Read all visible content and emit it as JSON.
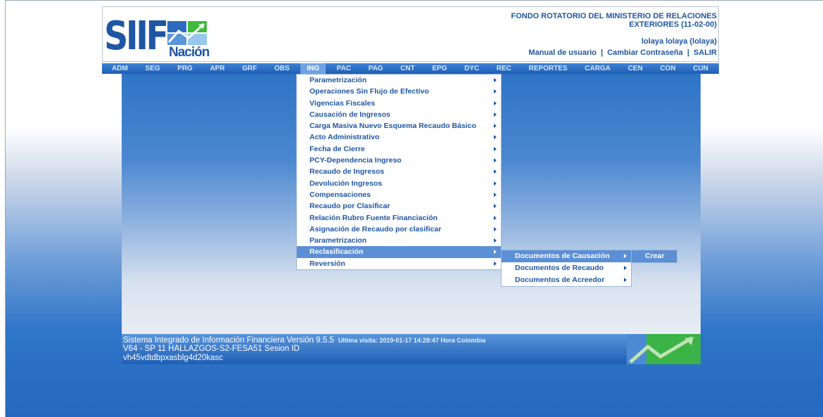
{
  "header": {
    "logo_text": "SIIF",
    "logo_subtext": "Nación",
    "org_name": "FONDO ROTATORIO DEL MINISTERIO DE RELACIONES EXTERIORES (11-02-00)",
    "user": "lolaya lolaya (lolaya)",
    "links": {
      "manual": "Manual de usuario",
      "change_password": "Cambiar Contraseña",
      "logout": "SALIR",
      "separator": "|"
    }
  },
  "menubar": {
    "items": [
      "ADM",
      "SEG",
      "PRG",
      "APR",
      "GRF",
      "OBS",
      "ING",
      "PAC",
      "PAG",
      "CNT",
      "EPG",
      "DYC",
      "REC",
      "REPORTES",
      "CARGA",
      "CEN",
      "CON",
      "CUN"
    ],
    "active": "ING"
  },
  "ing_menu": {
    "items": [
      "Parametrización",
      "Operaciones Sin Flujo de Efectivo",
      "Vigencias Fiscales",
      "Causación de Ingresos",
      "Carga Masiva Nuevo Esquema Recaudo Básico",
      "Acto Administrativo",
      "Fecha de Cierre",
      "PCY-Dependencia Ingreso",
      "Recaudo de Ingresos",
      "Devolución Ingresos",
      "Compensaciones",
      "Recaudo por Clasificar",
      "Relación Rubro Fuente Financiación",
      "Asignación de Recaudo por clasificar",
      "Parametrizacion",
      "Reclasificación",
      "Reversión"
    ],
    "active": "Reclasificación"
  },
  "reclasificacion_menu": {
    "items": [
      "Documentos de Causación",
      "Documentos de Recaudo",
      "Documentos de Acreedor"
    ],
    "active": "Documentos de Causación"
  },
  "causacion_menu": {
    "items": [
      "Crear"
    ],
    "active": "Crear"
  },
  "footer": {
    "system": "Sistema Integrado de Información Financiera Versión 9.5.5",
    "last_visit": "Ultima visita: 2019-01-17 14:28:47 Hora Colombia",
    "build": "V64 - SP 11 HALLAZGOS-S2-FESA51 Sesion ID",
    "session_id": "vh45vdtdbpxasblg4d20kasc"
  },
  "colors": {
    "brand_blue": "#1f56a3",
    "menu_active": "#6fa3e2",
    "dropdown_active": "#5b8fd6",
    "logo_green": "#3dbb3a"
  }
}
